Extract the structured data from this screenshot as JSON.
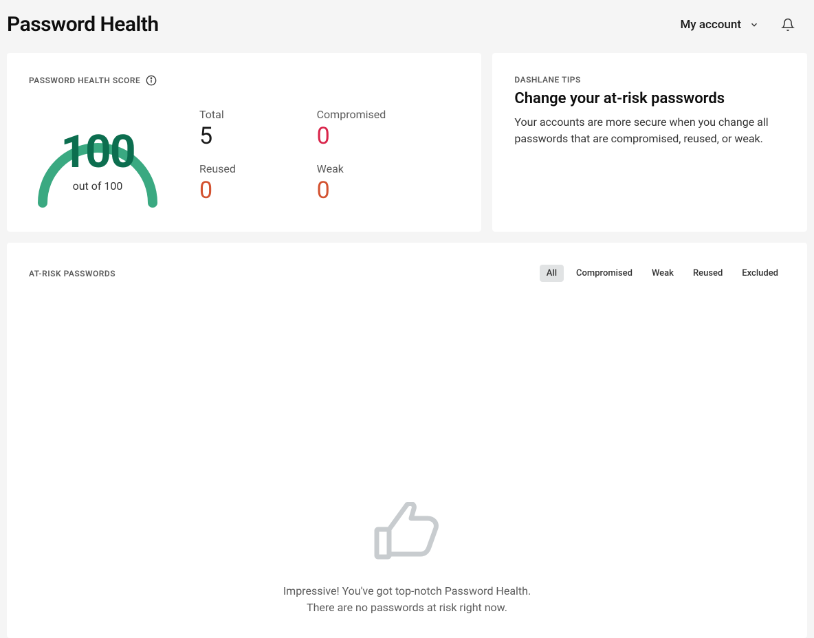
{
  "header": {
    "title": "Password Health",
    "account_label": "My account"
  },
  "score_card": {
    "section_label": "PASSWORD HEALTH SCORE",
    "score": "100",
    "score_sub": "out of 100",
    "stats": {
      "total_label": "Total",
      "total_value": "5",
      "compromised_label": "Compromised",
      "compromised_value": "0",
      "reused_label": "Reused",
      "reused_value": "0",
      "weak_label": "Weak",
      "weak_value": "0"
    }
  },
  "tips_card": {
    "section_label": "DASHLANE TIPS",
    "title": "Change your at-risk passwords",
    "body": "Your accounts are more secure when you change all passwords that are compromised, reused, or weak."
  },
  "list": {
    "section_label": "AT-RISK PASSWORDS",
    "filters": {
      "all": "All",
      "compromised": "Compromised",
      "weak": "Weak",
      "reused": "Reused",
      "excluded": "Excluded"
    },
    "empty_state": {
      "line1": "Impressive! You've got top-notch Password Health.",
      "line2": "There are no passwords at risk right now."
    }
  }
}
